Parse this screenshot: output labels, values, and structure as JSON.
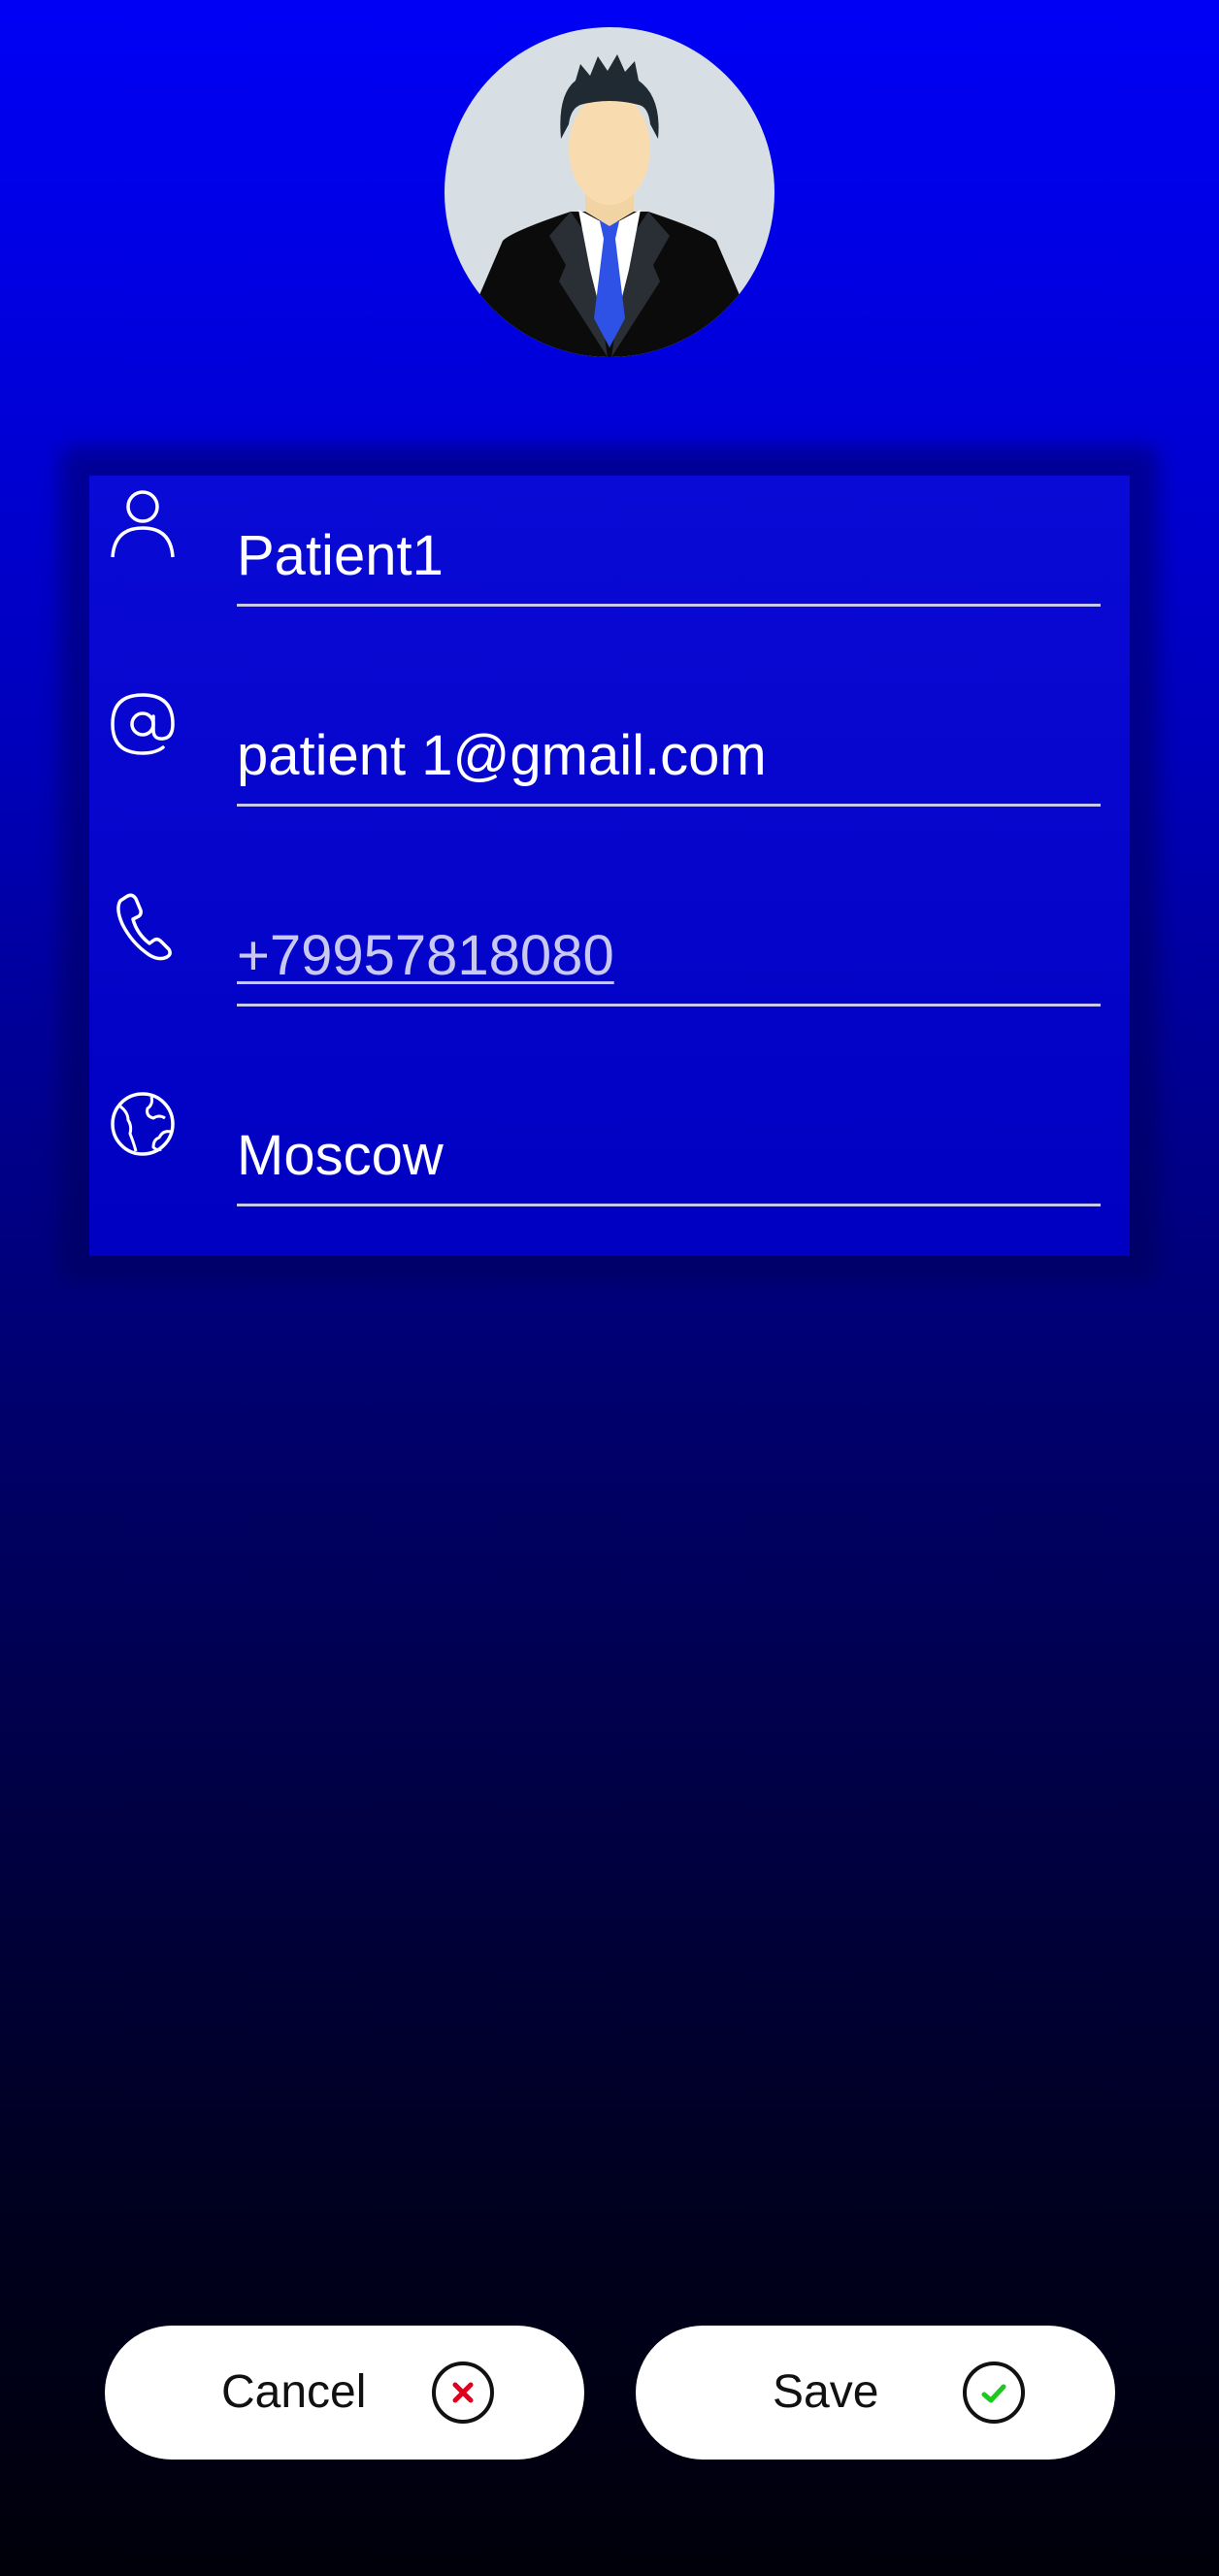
{
  "profile": {
    "avatar_icon": "businessman-avatar-icon"
  },
  "fields": {
    "name": {
      "icon": "person-icon",
      "value": "Patient1"
    },
    "email": {
      "icon": "at-sign-icon",
      "value": "patient 1@gmail.com"
    },
    "phone": {
      "icon": "phone-icon",
      "value": "+79957818080"
    },
    "city": {
      "icon": "globe-icon",
      "value": "Moscow"
    }
  },
  "actions": {
    "cancel_label": "Cancel",
    "cancel_icon": "close-circle-icon",
    "save_label": "Save",
    "save_icon": "check-circle-icon"
  },
  "colors": {
    "background_top": "#0000f5",
    "background_bottom": "#00000a",
    "card": "#0000c2",
    "text": "#ffffff",
    "phone_link": "#c8c8f0",
    "cancel_mark": "#e0001b",
    "save_mark": "#1ec81e"
  }
}
